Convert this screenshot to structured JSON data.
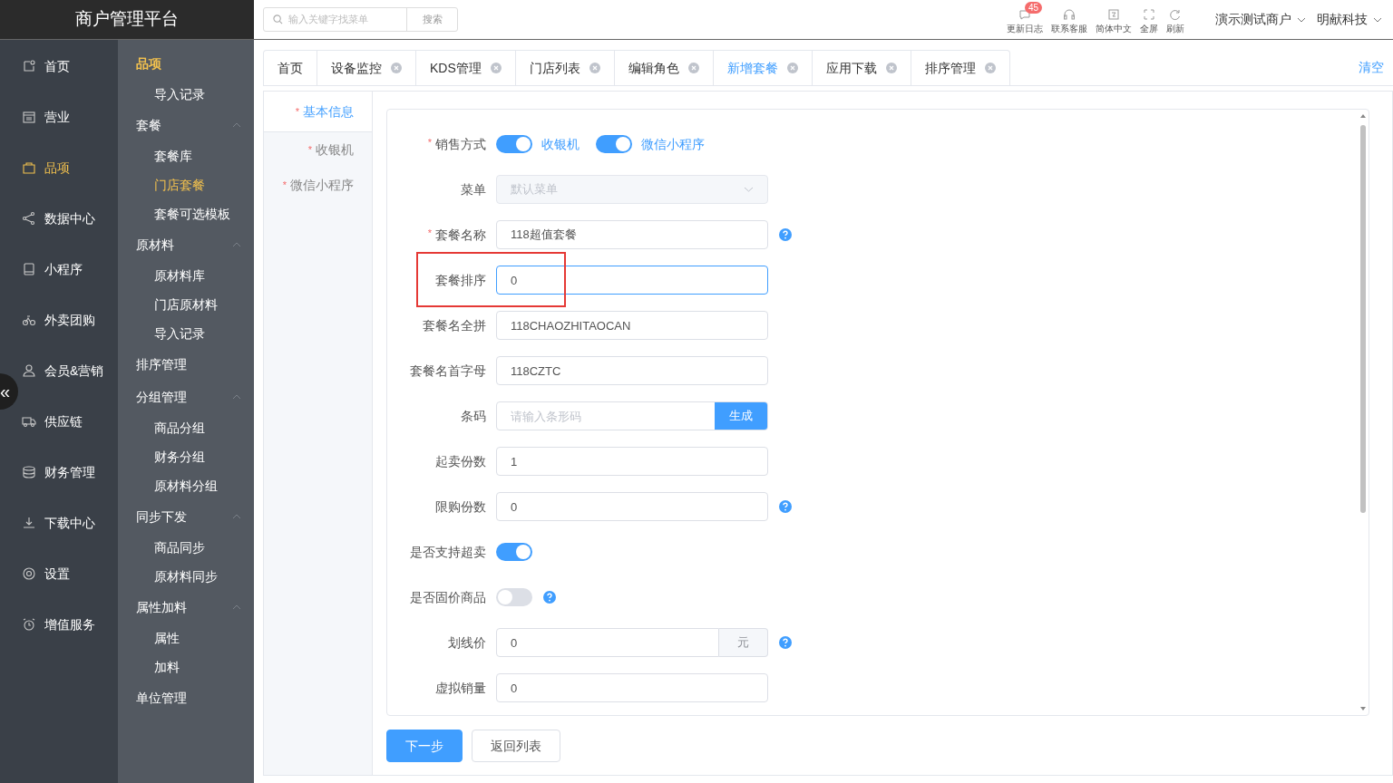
{
  "brand": "商户管理平台",
  "search": {
    "placeholder": "输入关键字找菜单",
    "button": "搜索"
  },
  "tools": [
    {
      "label": "更新日志",
      "badge": "45"
    },
    {
      "label": "联系客服"
    },
    {
      "label": "简体中文"
    },
    {
      "label": "全屏"
    },
    {
      "label": "刷新"
    }
  ],
  "account_menus": [
    "演示测试商户",
    "明献科技"
  ],
  "nav": [
    {
      "label": "首页",
      "selected": false
    },
    {
      "label": "营业",
      "selected": false
    },
    {
      "label": "品项",
      "selected": true
    },
    {
      "label": "数据中心",
      "selected": false
    },
    {
      "label": "小程序",
      "selected": false
    },
    {
      "label": "外卖团购",
      "selected": false
    },
    {
      "label": "会员&营销",
      "selected": false
    },
    {
      "label": "供应链",
      "selected": false
    },
    {
      "label": "财务管理",
      "selected": false
    },
    {
      "label": "下载中心",
      "selected": false
    },
    {
      "label": "设置",
      "selected": false
    },
    {
      "label": "增值服务",
      "selected": false
    }
  ],
  "collapse_button": "«",
  "submenu": [
    {
      "label": "品项",
      "kind": "title",
      "children": [
        {
          "label": "导入记录",
          "selected": false
        }
      ]
    },
    {
      "label": "套餐",
      "kind": "group",
      "expanded": true,
      "children": [
        {
          "label": "套餐库",
          "selected": false
        },
        {
          "label": "门店套餐",
          "selected": true
        },
        {
          "label": "套餐可选模板",
          "selected": false
        }
      ]
    },
    {
      "label": "原材料",
      "kind": "group",
      "expanded": true,
      "children": [
        {
          "label": "原材料库",
          "selected": false
        },
        {
          "label": "门店原材料",
          "selected": false
        },
        {
          "label": "导入记录",
          "selected": false
        }
      ]
    },
    {
      "label": "排序管理",
      "kind": "link"
    },
    {
      "label": "分组管理",
      "kind": "group",
      "expanded": true,
      "children": [
        {
          "label": "商品分组",
          "selected": false
        },
        {
          "label": "财务分组",
          "selected": false
        },
        {
          "label": "原材料分组",
          "selected": false
        }
      ]
    },
    {
      "label": "同步下发",
      "kind": "group",
      "expanded": true,
      "children": [
        {
          "label": "商品同步",
          "selected": false
        },
        {
          "label": "原材料同步",
          "selected": false
        }
      ]
    },
    {
      "label": "属性加料",
      "kind": "group",
      "expanded": true,
      "children": [
        {
          "label": "属性",
          "selected": false
        },
        {
          "label": "加料",
          "selected": false
        }
      ]
    },
    {
      "label": "单位管理",
      "kind": "link"
    }
  ],
  "tabs": [
    {
      "label": "首页",
      "closable": false,
      "selected": false
    },
    {
      "label": "设备监控",
      "closable": true,
      "selected": false
    },
    {
      "label": "KDS管理",
      "closable": true,
      "selected": false
    },
    {
      "label": "门店列表",
      "closable": true,
      "selected": false
    },
    {
      "label": "编辑角色",
      "closable": true,
      "selected": false
    },
    {
      "label": "新增套餐",
      "closable": true,
      "selected": true
    },
    {
      "label": "应用下载",
      "closable": true,
      "selected": false
    },
    {
      "label": "排序管理",
      "closable": true,
      "selected": false
    }
  ],
  "clear_tabs": "清空",
  "steps": [
    {
      "mark": "*",
      "label": "基本信息",
      "selected": true
    },
    {
      "mark": "*",
      "label": "收银机",
      "selected": false
    },
    {
      "mark": "*",
      "label": "微信小程序",
      "selected": false
    }
  ],
  "fields": [
    {
      "mark": "*",
      "label": "销售方式",
      "kind": "switches",
      "highlighted": false,
      "options": [
        {
          "label": "收银机",
          "on": true
        },
        {
          "label": "微信小程序",
          "on": true
        }
      ]
    },
    {
      "label": "菜单",
      "kind": "select",
      "highlighted": false,
      "disabled": true,
      "placeholder": "默认菜单"
    },
    {
      "mark": "*",
      "label": "套餐名称",
      "kind": "input",
      "highlighted": false,
      "value": "118超值套餐",
      "help": true
    },
    {
      "label": "套餐排序",
      "kind": "input",
      "highlighted": true,
      "focused": true,
      "value": "0"
    },
    {
      "label": "套餐名全拼",
      "kind": "input",
      "highlighted": false,
      "value": "118CHAOZHITAOCAN"
    },
    {
      "label": "套餐名首字母",
      "kind": "input",
      "highlighted": false,
      "value": "118CZTC"
    },
    {
      "label": "条码",
      "kind": "input-button",
      "highlighted": false,
      "placeholder": "请输入条形码",
      "button": "生成"
    },
    {
      "label": "起卖份数",
      "kind": "input",
      "highlighted": false,
      "value": "1"
    },
    {
      "label": "限购份数",
      "kind": "input",
      "highlighted": false,
      "value": "0",
      "help": true
    },
    {
      "label": "是否支持超卖",
      "kind": "switch",
      "highlighted": false,
      "on": true
    },
    {
      "label": "是否固价商品",
      "kind": "switch",
      "highlighted": false,
      "on": false,
      "help": true
    },
    {
      "label": "划线价",
      "kind": "input-suffix",
      "highlighted": false,
      "value": "0",
      "suffix": "元",
      "help": true
    },
    {
      "label": "虚拟销量",
      "kind": "input",
      "highlighted": false,
      "value": "0"
    }
  ],
  "actions": [
    {
      "label": "下一步",
      "kind": "primary"
    },
    {
      "label": "返回列表",
      "kind": "default"
    }
  ]
}
